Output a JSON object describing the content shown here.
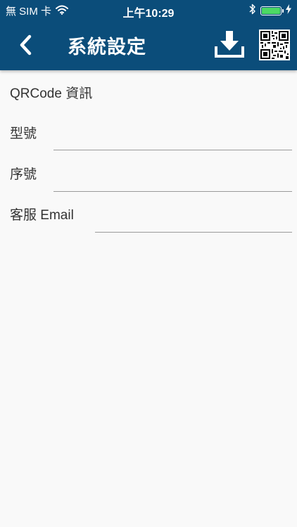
{
  "status_bar": {
    "carrier": "無 SIM 卡",
    "time": "上午10:29",
    "battery_level": 1.0,
    "battery_color": "#4cd964"
  },
  "header": {
    "title": "系統設定",
    "color": "#0b4d7a",
    "back_icon": "chevron-left-icon",
    "download_icon": "download-icon",
    "qr_icon": "qrcode-icon"
  },
  "section": {
    "title": "QRCode 資訊"
  },
  "fields": [
    {
      "label": "型號",
      "value": "",
      "placeholder": ""
    },
    {
      "label": "序號",
      "value": "",
      "placeholder": ""
    },
    {
      "label": "客服 Email",
      "value": "",
      "placeholder": ""
    }
  ]
}
